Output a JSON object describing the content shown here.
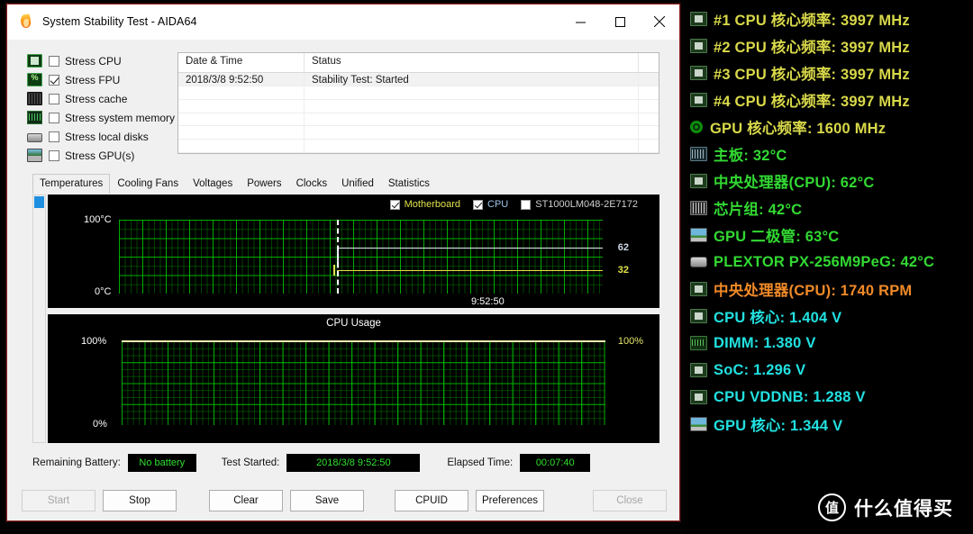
{
  "window": {
    "title": "System Stability Test - AIDA64",
    "icon": "flame-icon",
    "controls": {
      "minimize": "minimize-icon",
      "maximize": "maximize-icon",
      "close": "close-icon"
    }
  },
  "stress_options": [
    {
      "label": "Stress CPU",
      "checked": false,
      "icon": "cpu-chip-icon"
    },
    {
      "label": "Stress FPU",
      "checked": true,
      "icon": "fpu-percent-icon"
    },
    {
      "label": "Stress cache",
      "checked": false,
      "icon": "cache-icon"
    },
    {
      "label": "Stress system memory",
      "checked": false,
      "icon": "memory-module-icon"
    },
    {
      "label": "Stress local disks",
      "checked": false,
      "icon": "hard-disk-icon"
    },
    {
      "label": "Stress GPU(s)",
      "checked": false,
      "icon": "gpu-card-icon"
    }
  ],
  "log": {
    "columns": [
      "Date & Time",
      "Status"
    ],
    "rows": [
      {
        "datetime": "2018/3/8 9:52:50",
        "status": "Stability Test: Started"
      }
    ],
    "empty_rows": 5
  },
  "tabs": [
    {
      "label": "Temperatures",
      "active": true
    },
    {
      "label": "Cooling Fans",
      "active": false
    },
    {
      "label": "Voltages",
      "active": false
    },
    {
      "label": "Powers",
      "active": false
    },
    {
      "label": "Clocks",
      "active": false
    },
    {
      "label": "Unified",
      "active": false
    },
    {
      "label": "Statistics",
      "active": false
    }
  ],
  "chart_data": [
    {
      "type": "line",
      "title": "Temperatures",
      "xlabel": "",
      "ylabel": "°C",
      "ylim": [
        0,
        100
      ],
      "y_top_label": "100°C",
      "y_bottom_label": "0°C",
      "x_marker_label": "9:52:50",
      "grid": true,
      "legend_position": "top-right",
      "series": [
        {
          "name": "Motherboard",
          "color": "#e2e24a",
          "enabled": true,
          "current_value": 32,
          "unit": "°C",
          "value_label": "32"
        },
        {
          "name": "CPU",
          "color": "#dfe7f2",
          "enabled": true,
          "current_value": 62,
          "unit": "°C",
          "value_label": "62"
        },
        {
          "name": "ST1000LM048-2E7172",
          "color": "#888888",
          "enabled": false,
          "current_value": null,
          "unit": "°C",
          "value_label": ""
        }
      ]
    },
    {
      "type": "line",
      "title": "CPU Usage",
      "xlabel": "",
      "ylabel": "%",
      "ylim": [
        0,
        100
      ],
      "y_top_label": "100%",
      "y_bottom_label": "0%",
      "y_right_label": "100%",
      "grid": true,
      "series": [
        {
          "name": "CPU Usage",
          "color": "#f2f0b0",
          "enabled": true,
          "current_value": 100,
          "unit": "%",
          "value_label": "100%"
        }
      ]
    }
  ],
  "status": {
    "battery_label": "Remaining Battery:",
    "battery_value": "No battery",
    "started_label": "Test Started:",
    "started_value": "2018/3/8 9:52:50",
    "elapsed_label": "Elapsed Time:",
    "elapsed_value": "00:07:40"
  },
  "buttons": [
    {
      "label": "Start",
      "enabled": false
    },
    {
      "label": "Stop",
      "enabled": true
    },
    {
      "label": "Clear",
      "enabled": true
    },
    {
      "label": "Save",
      "enabled": true
    },
    {
      "label": "CPUID",
      "enabled": true
    },
    {
      "label": "Preferences",
      "enabled": true
    },
    {
      "label": "Close",
      "enabled": false
    }
  ],
  "osd": {
    "rows": [
      {
        "text": "#1 CPU 核心频率: 3997 MHz",
        "color": "#d8d84a",
        "icon": "cpu-chip-icon"
      },
      {
        "text": "#2 CPU 核心频率: 3997 MHz",
        "color": "#d8d84a",
        "icon": "cpu-chip-icon"
      },
      {
        "text": "#3 CPU 核心频率: 3997 MHz",
        "color": "#d8d84a",
        "icon": "cpu-chip-icon"
      },
      {
        "text": "#4 CPU 核心频率: 3997 MHz",
        "color": "#d8d84a",
        "icon": "cpu-chip-icon"
      },
      {
        "text": "GPU 核心频率: 1600 MHz",
        "color": "#d8d84a",
        "icon": "gpu-ring-icon"
      },
      {
        "text": "主板: 32°C",
        "color": "#32d832",
        "icon": "motherboard-icon"
      },
      {
        "text": "中央处理器(CPU): 62°C",
        "color": "#32d832",
        "icon": "cpu-chip-icon"
      },
      {
        "text": "芯片组: 42°C",
        "color": "#32d832",
        "icon": "chipset-icon"
      },
      {
        "text": "GPU 二极管: 63°C",
        "color": "#32d832",
        "icon": "gpu-card-icon"
      },
      {
        "text": "PLEXTOR PX-256M9PeG: 42°C",
        "color": "#32d832",
        "icon": "ssd-icon"
      },
      {
        "text": "中央处理器(CPU): 1740 RPM",
        "color": "#f08a28",
        "icon": "cpu-chip-icon"
      },
      {
        "text": "CPU 核心: 1.404 V",
        "color": "#22e0e0",
        "icon": "cpu-chip-icon"
      },
      {
        "text": "DIMM: 1.380 V",
        "color": "#22e0e0",
        "icon": "memory-module-icon"
      },
      {
        "text": "SoC: 1.296 V",
        "color": "#22e0e0",
        "icon": "cpu-chip-icon"
      },
      {
        "text": "CPU VDDNB: 1.288 V",
        "color": "#22e0e0",
        "icon": "cpu-chip-icon"
      },
      {
        "text": "GPU 核心: 1.344 V",
        "color": "#22e0e0",
        "icon": "gpu-card-icon"
      }
    ]
  },
  "watermark": {
    "badge": "值",
    "text": "什么值得买"
  }
}
